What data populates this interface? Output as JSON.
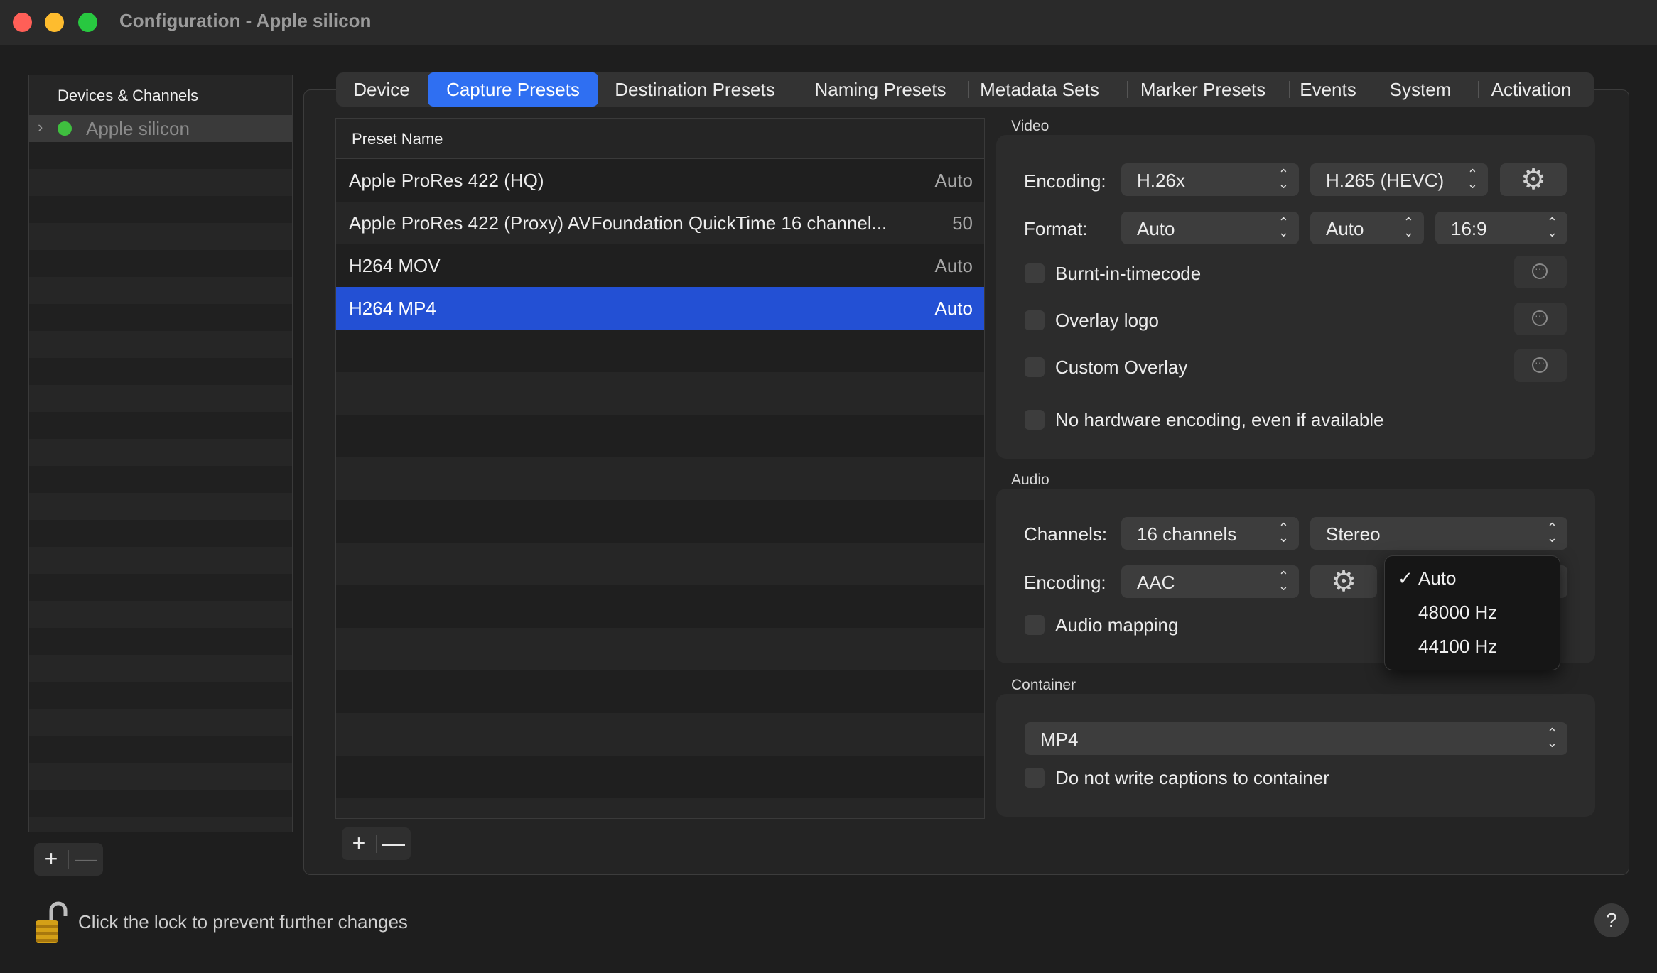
{
  "window": {
    "title": "Configuration - Apple silicon",
    "traffic_lights": [
      "#ff5f57",
      "#febc2e",
      "#28c840"
    ]
  },
  "sidebar": {
    "header": "Devices & Channels",
    "items": [
      {
        "label": "Apple silicon",
        "status_color": "#3fbf3f"
      }
    ],
    "add_label": "+",
    "remove_label": "—"
  },
  "tabs": [
    {
      "label": "Device"
    },
    {
      "label": "Capture Presets",
      "selected": true
    },
    {
      "label": "Destination Presets"
    },
    {
      "label": "Naming Presets"
    },
    {
      "label": "Metadata Sets"
    },
    {
      "label": "Marker Presets"
    },
    {
      "label": "Events"
    },
    {
      "label": "System"
    },
    {
      "label": "Activation"
    }
  ],
  "presets": {
    "column_header": "Preset Name",
    "rows": [
      {
        "name": "Apple ProRes 422 (HQ)",
        "value": "Auto"
      },
      {
        "name": "Apple ProRes 422 (Proxy) AVFoundation QuickTime 16 channel...",
        "value": "50"
      },
      {
        "name": "H264 MOV",
        "value": "Auto"
      },
      {
        "name": "H264 MP4",
        "value": "Auto",
        "selected": true
      }
    ],
    "add_label": "+",
    "remove_label": "—"
  },
  "video": {
    "title": "Video",
    "encoding_label": "Encoding:",
    "encoding_family": "H.26x",
    "encoding_codec": "H.265 (HEVC)",
    "format_label": "Format:",
    "format_1": "Auto",
    "format_2": "Auto",
    "format_3": "16:9",
    "options": [
      {
        "label": "Burnt-in-timecode"
      },
      {
        "label": "Overlay logo"
      },
      {
        "label": "Custom Overlay"
      }
    ],
    "no_hw_label": "No hardware encoding, even if available"
  },
  "audio": {
    "title": "Audio",
    "channels_label": "Channels:",
    "channels_value": "16 channels",
    "layout_value": "Stereo",
    "encoding_label": "Encoding:",
    "encoding_value": "AAC",
    "mapping_label": "Audio mapping"
  },
  "samplerate_menu": {
    "checkmark": "✓",
    "items": [
      "Auto",
      "48000 Hz",
      "44100 Hz"
    ],
    "selected": "Auto"
  },
  "container": {
    "title": "Container",
    "value": "MP4",
    "captions_label": "Do not write captions to container"
  },
  "footer": {
    "lock_text": "Click the lock to prevent further changes",
    "help_label": "?"
  },
  "colors": {
    "accent": "#2f6ff2",
    "selection": "#2350d4",
    "background": "#1e1e1e"
  }
}
